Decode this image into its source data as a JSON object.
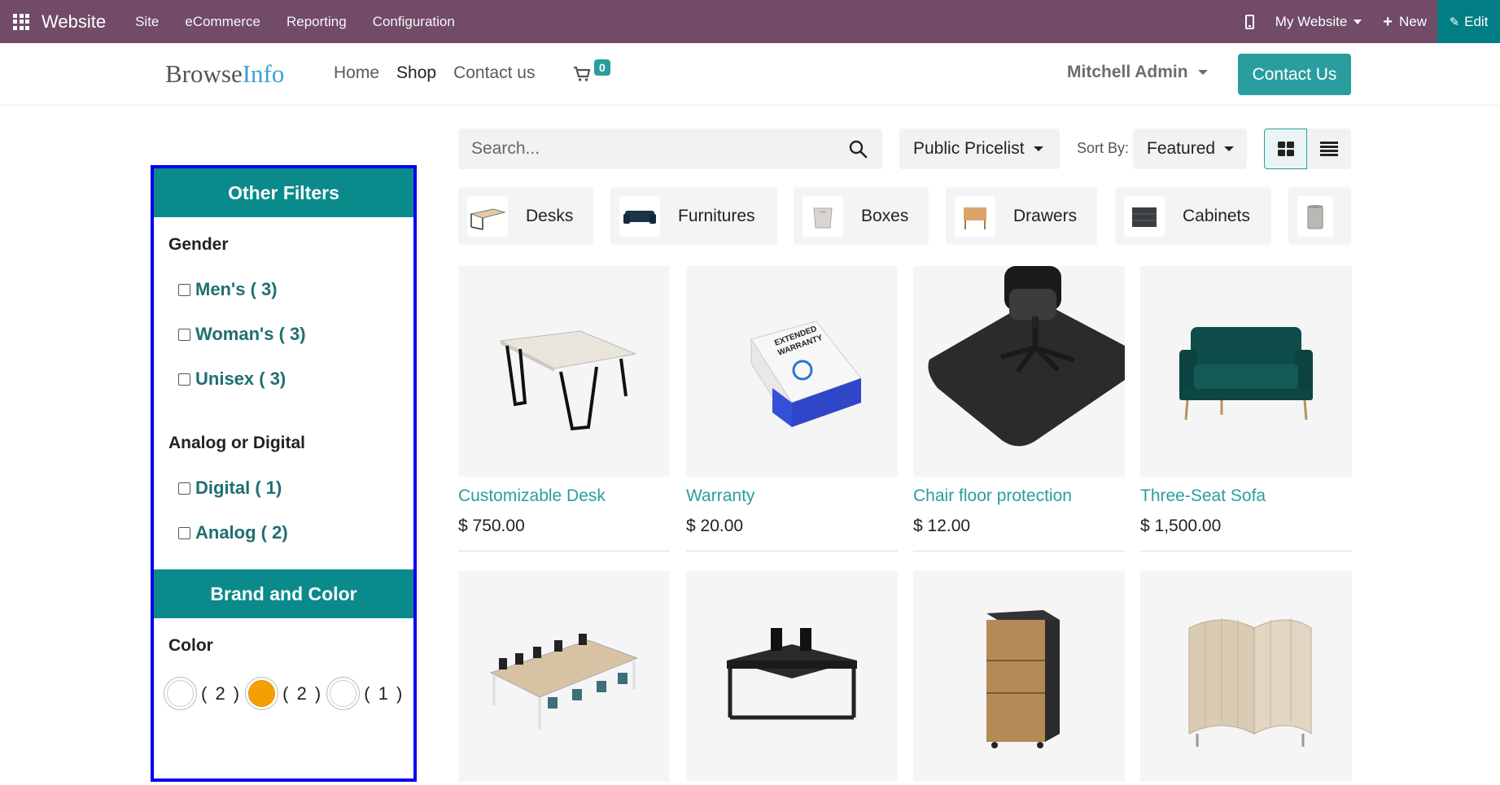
{
  "adminbar": {
    "brand": "Website",
    "menu": [
      "Site",
      "eCommerce",
      "Reporting",
      "Configuration"
    ],
    "website_selector": "My Website",
    "new_label": "New",
    "edit_label": "Edit"
  },
  "header": {
    "logo_part1": "Browse",
    "logo_part2": "Info",
    "nav": [
      "Home",
      "Shop",
      "Contact us"
    ],
    "active_nav": "Shop",
    "cart_count": "0",
    "user": "Mitchell Admin",
    "contact_button": "Contact Us"
  },
  "sidebar": {
    "section1_title": "Other Filters",
    "gender_label": "Gender",
    "gender_options": [
      "Men's ( 3)",
      "Woman's ( 3)",
      "Unisex ( 3)"
    ],
    "analog_label": "Analog or Digital",
    "analog_options": [
      "Digital ( 1)",
      "Analog ( 2)"
    ],
    "section2_title": "Brand and Color",
    "color_label": "Color",
    "colors": [
      {
        "hex": "#ffffff",
        "count": "( 2 )"
      },
      {
        "hex": "#f5a000",
        "count": "( 2 )"
      },
      {
        "hex": "#ffffff",
        "count": "( 1 )"
      }
    ]
  },
  "toolbar": {
    "search_placeholder": "Search...",
    "pricelist": "Public Pricelist",
    "sort_label": "Sort By:",
    "sort_value": "Featured"
  },
  "categories": [
    "Desks",
    "Furnitures",
    "Boxes",
    "Drawers",
    "Cabinets",
    ""
  ],
  "products": [
    {
      "name": "Customizable Desk",
      "price": "$ 750.00"
    },
    {
      "name": "Warranty",
      "price": "$ 20.00"
    },
    {
      "name": "Chair floor protection",
      "price": "$ 12.00"
    },
    {
      "name": "Three-Seat Sofa",
      "price": "$ 1,500.00"
    }
  ],
  "colors": {
    "admin_purple": "#714b67",
    "teal": "#2a9d9f",
    "edit_teal": "#017e84",
    "highlight_blue": "#0000ee"
  }
}
